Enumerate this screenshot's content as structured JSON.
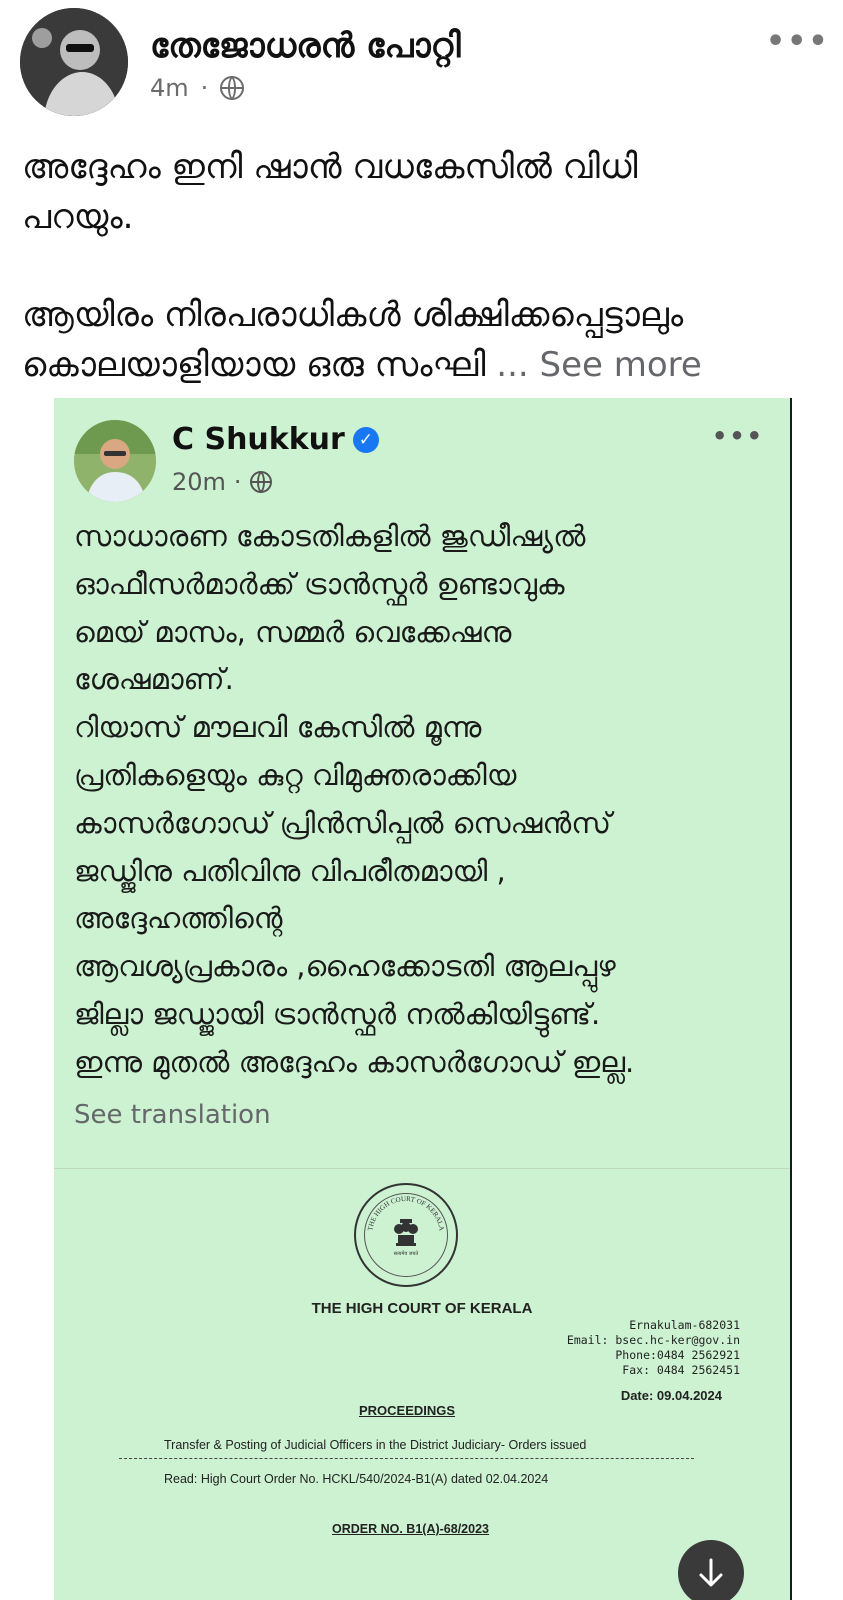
{
  "post": {
    "author": "തേജോധരൻ പോറ്റി",
    "time": "4m",
    "meta_separator": "·",
    "text_lines_1": [
      "അദ്ദേഹം ഇനി ഷാൻ വധകേസിൽ വിധി",
      "പറയും."
    ],
    "text_lines_2": [
      "ആയിരം നിരപരാധികൾ ശിക്ഷിക്കപ്പെട്ടാലും"
    ],
    "text_line_last": "കൊലയാളിയായ ഒരു  സംഘി",
    "see_more": "... See more",
    "more_icon": "more-horizontal-icon"
  },
  "shared": {
    "author": "C Shukkur",
    "verified_icon": "verified-badge-icon",
    "time": "20m",
    "meta_separator": "·",
    "body_lines": [
      "സാധാരണ കോടതികളിൽ ജുഡീഷ്യൽ",
      "ഓഫീസർമാർക്ക് ട്രാൻസ്ഫർ ഉണ്ടാവുക",
      "മെയ് മാസം, സമ്മർ വെക്കേഷനു",
      "ശേഷമാണ്.",
      "റിയാസ് മൗലവി കേസിൽ മൂന്നു",
      "പ്രതികളെയും കുറ്റ വിമുക്തരാക്കിയ",
      "കാസർഗോഡ് പ്രിൻസിപ്പൽ സെഷൻസ്",
      "ജഡ്ജിനു പതിവിനു വിപരീതമായി ,",
      "അദ്ദേഹത്തിന്റെ",
      "ആവശ്യപ്രകാരം ,ഹൈക്കോടതി ആലപ്പുഴ",
      "ജില്ലാ ജഡ്ജായി ട്രാൻസ്ഫർ നൽകിയിട്ടുണ്ട്.",
      "ഇന്നു മുതൽ അദ്ദേഹം കാസർഗോഡ് ഇല്ല."
    ],
    "see_translation": "See translation",
    "card_color": "#cdf2d2"
  },
  "document": {
    "seal_text_top": "THE HIGH COURT OF KERALA",
    "seal_text_bottom": "सत्यमेव जयते",
    "title": "THE HIGH COURT OF KERALA",
    "address_lines": [
      "Ernakulam-682031",
      "Email: bsec.hc-ker@gov.in",
      "Phone:0484 2562921",
      "Fax: 0484 2562451"
    ],
    "date": "Date: 09.04.2024",
    "proceedings": "PROCEEDINGS",
    "subject": "Transfer & Posting of Judicial Officers in the District Judiciary- Orders issued",
    "read": "Read:  High Court Order No. HCKL/540/2024-B1(A) dated 02.04.2024",
    "order_no": "ORDER NO. B1(A)-68/2023"
  },
  "download_icon": "arrow-down-icon"
}
